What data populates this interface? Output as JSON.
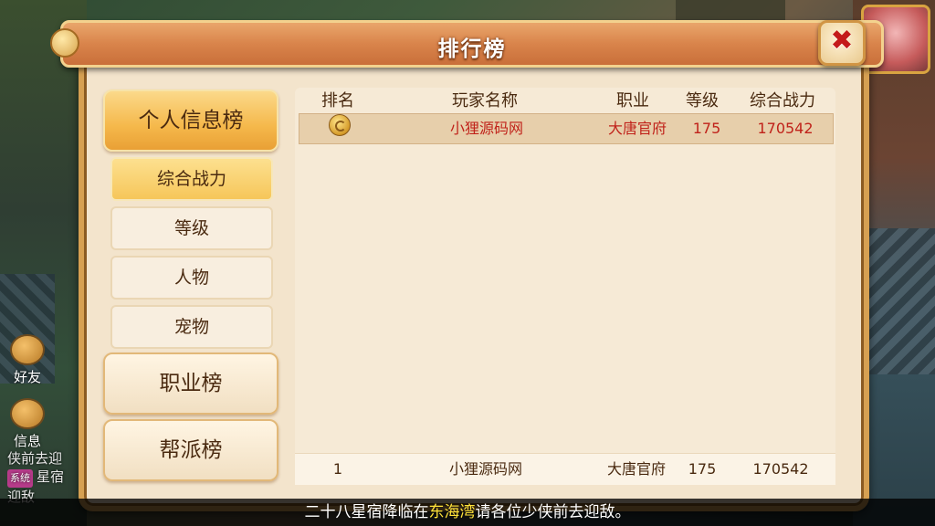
{
  "window": {
    "title": "排行榜"
  },
  "sidebar_hud": {
    "friends_label": "好友",
    "info_label": "信息"
  },
  "chat": {
    "line1": "侠前去迎",
    "badge": "系统",
    "line2": "星宿",
    "line3": "迎敌"
  },
  "menu": {
    "personal": "个人信息榜",
    "sub_items": [
      "综合战力",
      "等级",
      "人物",
      "宠物"
    ],
    "job": "职业榜",
    "guild": "帮派榜"
  },
  "table": {
    "headers": {
      "rank": "排名",
      "name": "玩家名称",
      "job": "职业",
      "level": "等级",
      "power": "综合战力"
    },
    "rows": [
      {
        "rank_icon": "gold-medal-icon",
        "name": "小狸源码网",
        "job": "大唐官府",
        "level": "175",
        "power": "170542"
      }
    ],
    "my_rank": {
      "rank": "1",
      "name": "小狸源码网",
      "job": "大唐官府",
      "level": "175",
      "power": "170542"
    }
  },
  "marquee": {
    "before": "二十八星宿降临在",
    "highlight": "东海湾",
    "after": "请各位少侠前去迎敌。"
  },
  "colors": {
    "accent": "#d9844b",
    "highlight_row": "#e7cfab",
    "red_text": "#c0221a",
    "marquee_highlight": "#ffe23a"
  }
}
